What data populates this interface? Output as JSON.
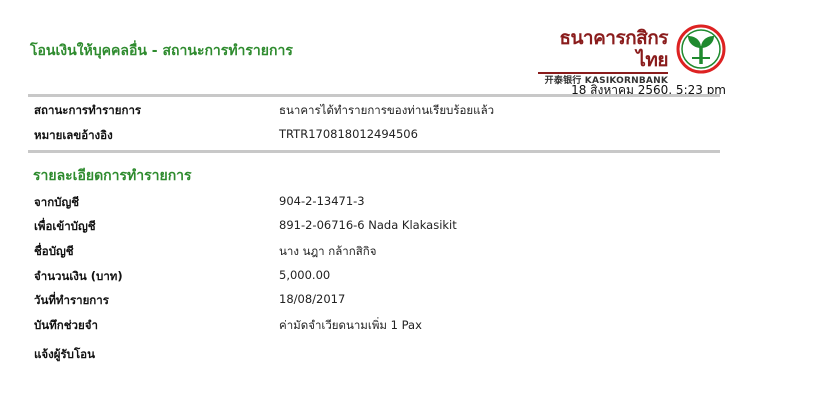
{
  "header": {
    "title": "โอนเงินให้บุคคลอื่น - สถานะการทำรายการ",
    "bank_name_thai": "ธนาคารกสิกรไทย",
    "bank_name_eng": "开泰银行 KASIKORNBANK",
    "datetime": "18 สิงหาคม 2560, 5:23 pm"
  },
  "status": [
    {
      "label": "สถานะการทำรายการ",
      "value": "ธนาคารได้ทำรายการของท่านเรียบร้อยแล้ว"
    },
    {
      "label": "หมายเลขอ้างอิง",
      "value": "TRTR170818012494506"
    }
  ],
  "details": {
    "title": "รายละเอียดการทำรายการ",
    "rows": [
      {
        "label": "จากบัญชี",
        "value": "904-2-13471-3"
      },
      {
        "label": "เพื่อเข้าบัญชี",
        "value": "891-2-06716-6 Nada Klakasikit"
      },
      {
        "label": "ชื่อบัญชี",
        "value": "นาง นฎา กล้ากสิกิจ"
      },
      {
        "label": "จำนวนเงิน (บาท)",
        "value": "5,000.00"
      },
      {
        "label": "วันที่ทำรายการ",
        "value": "18/08/2017"
      },
      {
        "label": "บันทึกช่วยจำ",
        "value": "ค่ามัดจำเวียดนามเพิ่ม 1 Pax"
      },
      {
        "label": "แจ้งผู้รับโอน",
        "value": ""
      }
    ]
  },
  "colors": {
    "title_green": "#2e8b2e",
    "brand_green": "#1f8a2e",
    "brand_red": "#8a1c1c"
  }
}
